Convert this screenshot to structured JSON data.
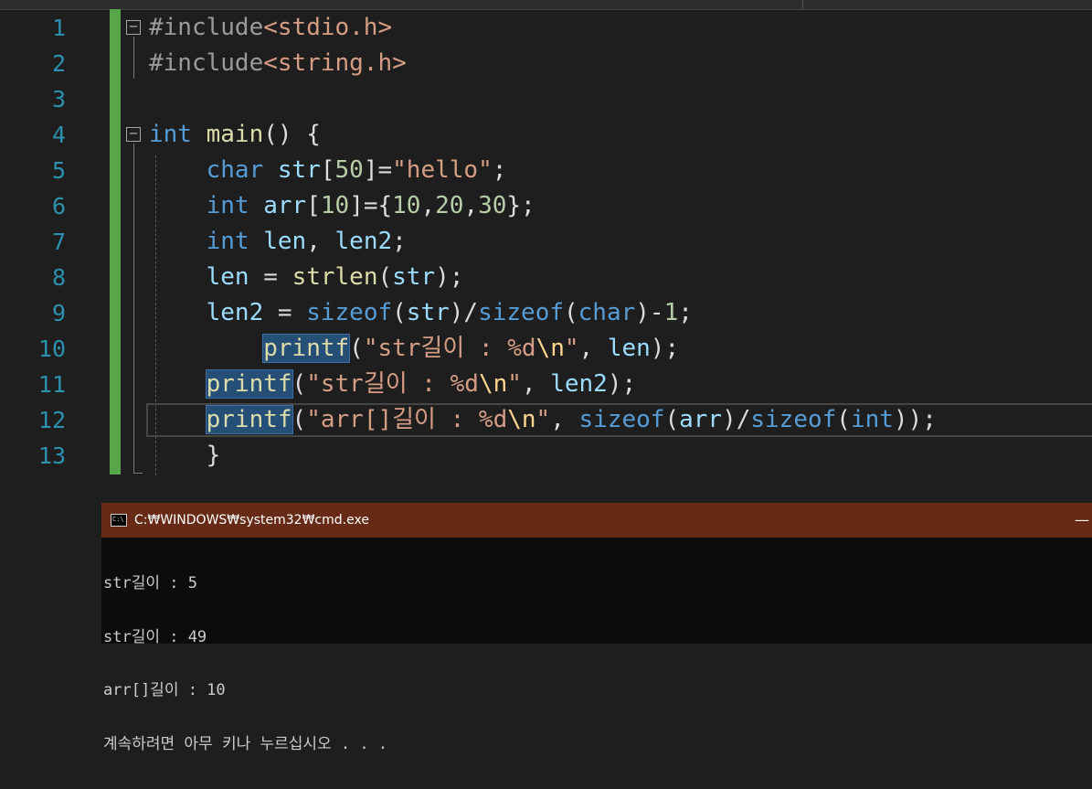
{
  "editor": {
    "line_numbers": [
      "1",
      "2",
      "3",
      "4",
      "5",
      "6",
      "7",
      "8",
      "9",
      "10",
      "11",
      "12",
      "13"
    ],
    "lines": [
      [
        {
          "c": "pp",
          "t": "#include"
        },
        {
          "c": "str",
          "t": "<stdio.h>"
        }
      ],
      [
        {
          "c": "pp",
          "t": "#include"
        },
        {
          "c": "str",
          "t": "<string.h>"
        }
      ],
      [],
      [
        {
          "c": "kw",
          "t": "int"
        },
        {
          "c": "",
          "t": " "
        },
        {
          "c": "fn",
          "t": "main"
        },
        {
          "c": "",
          "t": "() {"
        }
      ],
      [
        {
          "c": "",
          "t": "    "
        },
        {
          "c": "kw",
          "t": "char"
        },
        {
          "c": "",
          "t": " "
        },
        {
          "c": "var",
          "t": "str"
        },
        {
          "c": "",
          "t": "["
        },
        {
          "c": "num",
          "t": "50"
        },
        {
          "c": "",
          "t": "]="
        },
        {
          "c": "str",
          "t": "\"hello\""
        },
        {
          "c": "",
          "t": ";"
        }
      ],
      [
        {
          "c": "",
          "t": "    "
        },
        {
          "c": "kw",
          "t": "int"
        },
        {
          "c": "",
          "t": " "
        },
        {
          "c": "var",
          "t": "arr"
        },
        {
          "c": "",
          "t": "["
        },
        {
          "c": "num",
          "t": "10"
        },
        {
          "c": "",
          "t": "]={"
        },
        {
          "c": "num",
          "t": "10"
        },
        {
          "c": "",
          "t": ","
        },
        {
          "c": "num",
          "t": "20"
        },
        {
          "c": "",
          "t": ","
        },
        {
          "c": "num",
          "t": "30"
        },
        {
          "c": "",
          "t": "};"
        }
      ],
      [
        {
          "c": "",
          "t": "    "
        },
        {
          "c": "kw",
          "t": "int"
        },
        {
          "c": "",
          "t": " "
        },
        {
          "c": "var",
          "t": "len"
        },
        {
          "c": "",
          "t": ", "
        },
        {
          "c": "var",
          "t": "len2"
        },
        {
          "c": "",
          "t": ";"
        }
      ],
      [
        {
          "c": "",
          "t": "    "
        },
        {
          "c": "var",
          "t": "len"
        },
        {
          "c": "",
          "t": " = "
        },
        {
          "c": "fn",
          "t": "strlen"
        },
        {
          "c": "",
          "t": "("
        },
        {
          "c": "var",
          "t": "str"
        },
        {
          "c": "",
          "t": ");"
        }
      ],
      [
        {
          "c": "",
          "t": "    "
        },
        {
          "c": "var",
          "t": "len2"
        },
        {
          "c": "",
          "t": " = "
        },
        {
          "c": "kw",
          "t": "sizeof"
        },
        {
          "c": "",
          "t": "("
        },
        {
          "c": "var",
          "t": "str"
        },
        {
          "c": "",
          "t": ")/"
        },
        {
          "c": "kw",
          "t": "sizeof"
        },
        {
          "c": "",
          "t": "("
        },
        {
          "c": "kw",
          "t": "char"
        },
        {
          "c": "",
          "t": ")-"
        },
        {
          "c": "num",
          "t": "1"
        },
        {
          "c": "",
          "t": ";"
        }
      ],
      [
        {
          "c": "",
          "t": "        "
        },
        {
          "c": "fn hl",
          "t": "printf"
        },
        {
          "c": "",
          "t": "("
        },
        {
          "c": "str",
          "t": "\"str길이 : %d"
        },
        {
          "c": "esc",
          "t": "\\n"
        },
        {
          "c": "str",
          "t": "\""
        },
        {
          "c": "",
          "t": ", "
        },
        {
          "c": "var",
          "t": "len"
        },
        {
          "c": "",
          "t": ");"
        }
      ],
      [
        {
          "c": "",
          "t": "    "
        },
        {
          "c": "fn hl",
          "t": "printf"
        },
        {
          "c": "",
          "t": "("
        },
        {
          "c": "str",
          "t": "\"str길이 : %d"
        },
        {
          "c": "esc",
          "t": "\\n"
        },
        {
          "c": "str",
          "t": "\""
        },
        {
          "c": "",
          "t": ", "
        },
        {
          "c": "var",
          "t": "len2"
        },
        {
          "c": "",
          "t": ");"
        }
      ],
      [
        {
          "c": "",
          "t": "    "
        },
        {
          "c": "fn hl",
          "t": "printf"
        },
        {
          "c": "",
          "t": "("
        },
        {
          "c": "str",
          "t": "\"arr[]길이 : %d"
        },
        {
          "c": "esc",
          "t": "\\n"
        },
        {
          "c": "str",
          "t": "\""
        },
        {
          "c": "",
          "t": ", "
        },
        {
          "c": "kw",
          "t": "sizeof"
        },
        {
          "c": "",
          "t": "("
        },
        {
          "c": "var",
          "t": "arr"
        },
        {
          "c": "",
          "t": ")/"
        },
        {
          "c": "kw",
          "t": "sizeof"
        },
        {
          "c": "",
          "t": "("
        },
        {
          "c": "kw",
          "t": "int"
        },
        {
          "c": "",
          "t": "));"
        }
      ],
      [
        {
          "c": "",
          "t": "    }"
        }
      ]
    ]
  },
  "console": {
    "title": "C:₩WINDOWS₩system32₩cmd.exe",
    "icon_text": "C:\\",
    "minimize_glyph": "—",
    "output_lines": [
      "str길이 : 5",
      "str길이 : 49",
      "arr[]길이 : 10",
      "계속하려면 아무 키나 누르십시오 . . ."
    ]
  },
  "colors": {
    "editor_bg": "#1e1e1e",
    "keyword": "#569cd6",
    "string": "#d69d85",
    "function": "#dcdcaa",
    "variable": "#9cdcfe",
    "number": "#b5cea8",
    "line_number": "#2b91af",
    "change_bar": "#57a64a",
    "cmd_titlebar": "#672a17"
  }
}
